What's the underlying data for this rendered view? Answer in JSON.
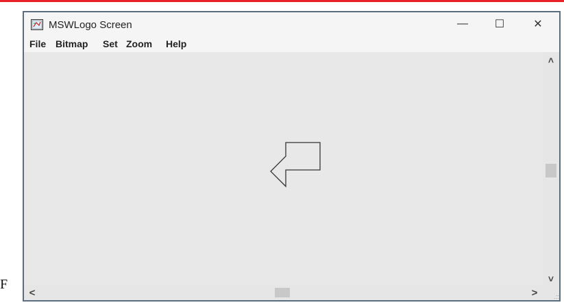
{
  "accent_top_rule": "#e8202a",
  "window": {
    "title": "MSWLogo Screen",
    "icon": "mswlogo-app-icon",
    "controls": {
      "minimize": "—",
      "maximize": "☐",
      "close": "✕"
    }
  },
  "menu": {
    "items": [
      "File",
      "Bitmap",
      "Set",
      "Zoom",
      "Help"
    ]
  },
  "scrollbars": {
    "up": "˄",
    "down": "˅",
    "left": "<",
    "right": ">",
    "grip": ".::"
  },
  "stray_text": "F",
  "turtle_icon": "turtle-arrow-icon"
}
